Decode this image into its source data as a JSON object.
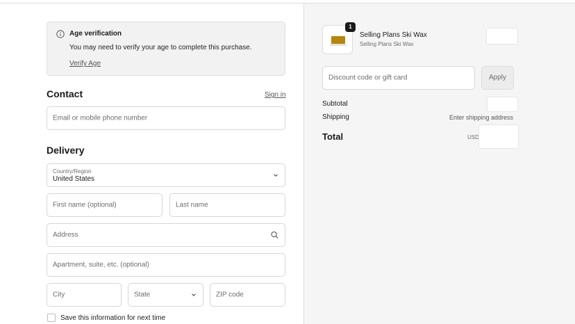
{
  "notice": {
    "title": "Age verification",
    "text": "You may need to verify your age to complete this purchase.",
    "link": "Verify Age",
    "icon": "info-icon"
  },
  "contact": {
    "heading": "Contact",
    "sign_in": "Sign in",
    "email_placeholder": "Email or mobile phone number"
  },
  "delivery": {
    "heading": "Delivery",
    "country_label": "Country/Region",
    "country_value": "United States",
    "first_name_placeholder": "First name (optional)",
    "last_name_placeholder": "Last name",
    "address_placeholder": "Address",
    "apartment_placeholder": "Apartment, suite, etc. (optional)",
    "city_placeholder": "City",
    "state_placeholder": "State",
    "zip_placeholder": "ZIP code",
    "save_info_label": "Save this information for next time"
  },
  "summary": {
    "product_name": "Selling Plans Ski Wax",
    "product_subtitle": "Selling Plans Ski Wax",
    "quantity": "1",
    "discount_placeholder": "Discount code or gift card",
    "apply_label": "Apply",
    "subtotal_label": "Subtotal",
    "shipping_label": "Shipping",
    "shipping_value": "Enter shipping address",
    "total_label": "Total",
    "currency": "USD"
  },
  "colors": {
    "wax": "#b8860b",
    "badge": "#1a1a1a",
    "summary_bg": "#f5f5f5"
  }
}
